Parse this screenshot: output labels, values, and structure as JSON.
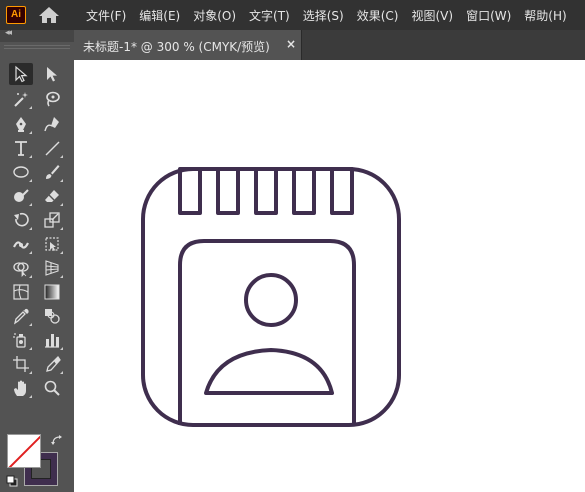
{
  "app": {
    "logo_text": "Ai"
  },
  "menu": {
    "items": [
      "文件(F)",
      "编辑(E)",
      "对象(O)",
      "文字(T)",
      "选择(S)",
      "效果(C)",
      "视图(V)",
      "窗口(W)",
      "帮助(H)"
    ]
  },
  "document_tab": {
    "title": "未标题-1* @ 300 % (CMYK/预览)",
    "close_label": "×"
  },
  "toolbar": {
    "collapse_label": "◂◂"
  },
  "colors": {
    "stroke": "#3f2e4e",
    "fill": "#ffffff",
    "accent": "#ff9a00"
  }
}
